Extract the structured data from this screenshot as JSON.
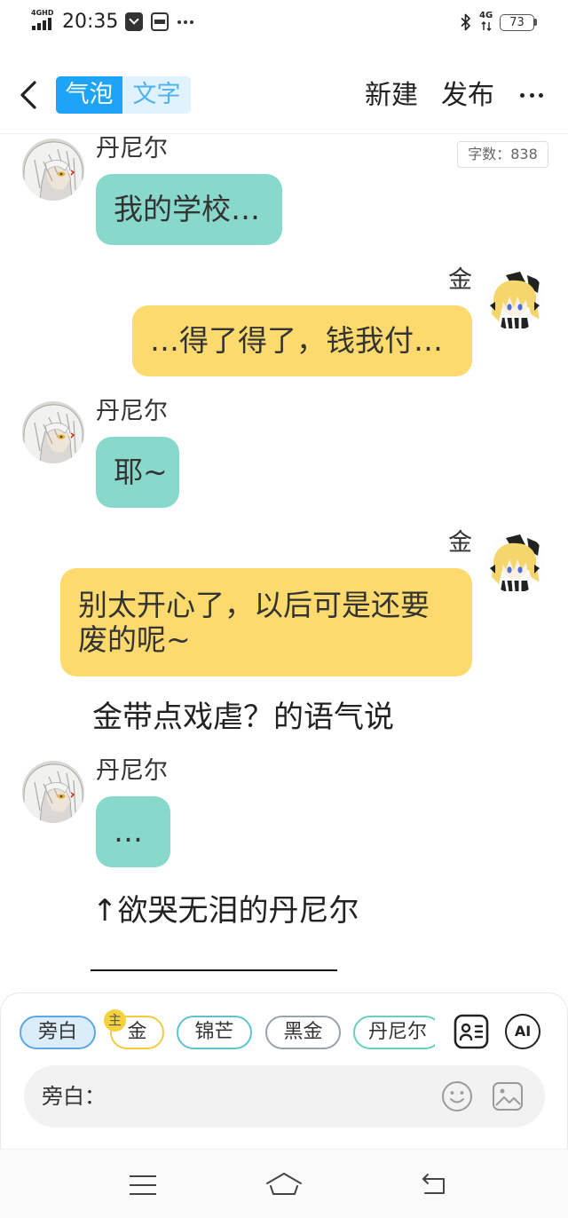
{
  "status_bar": {
    "network_type": "4GHD",
    "time": "20:35",
    "notification_icons": [
      "message-icon",
      "wallet-icon",
      "more-notifications-icon"
    ],
    "bluetooth_icon": "bluetooth-icon",
    "mobile_data": "4G",
    "battery_level": "73"
  },
  "header": {
    "back_icon": "chevron-left-icon",
    "mode_tabs": [
      {
        "label": "气泡",
        "active": true
      },
      {
        "label": "文字",
        "active": false
      }
    ],
    "new_label": "新建",
    "publish_label": "发布",
    "more_icon": "more-icon"
  },
  "word_count": "字数：838",
  "colors": {
    "accent": "#1ea4f6",
    "left_bubble": "#89d8cc",
    "right_bubble": "#fdda6d",
    "selected_chip_border": "#5ba7e8",
    "badge": "#f5d23c"
  },
  "conversation": [
    {
      "speaker": "丹尼尔",
      "avatar": "daniel-avatar",
      "text": "我的学校…"
    },
    {
      "speaker": "金",
      "avatar": "jin-avatar",
      "text": "…得了得了，钱我付…"
    },
    {
      "speaker": "丹尼尔",
      "avatar": "daniel-avatar",
      "text": "耶~"
    },
    {
      "speaker": "金",
      "avatar": "jin-avatar",
      "text": "别太开心了，以后可是还要废的呢~"
    },
    {
      "narration": "金带点戏虐？的语气说"
    },
    {
      "speaker": "丹尼尔",
      "avatar": "daniel-avatar",
      "text": "…"
    },
    {
      "narration": "↑欲哭无泪的丹尼尔"
    }
  ],
  "role_bar": {
    "roles": [
      {
        "label": "旁白",
        "selected": true,
        "border_color": "#5ba7e8"
      },
      {
        "label": "金",
        "badge": "主",
        "border_color": "#f1cd3e"
      },
      {
        "label": "锦芒",
        "border_color": "#5ec3cf"
      },
      {
        "label": "黑金",
        "border_color": "#9aa2ab"
      },
      {
        "label": "丹尼尔",
        "border_color": "#67d0c2"
      }
    ],
    "character_card_icon": "character-card-icon",
    "ai_icon": "ai-icon",
    "ai_label": "AI"
  },
  "composer": {
    "speaker_label": "旁白：",
    "emoji_icon": "smile-icon",
    "image_icon": "image-icon"
  },
  "nav_bar": {
    "icons": [
      "menu-icon",
      "home-icon",
      "back-icon"
    ]
  }
}
